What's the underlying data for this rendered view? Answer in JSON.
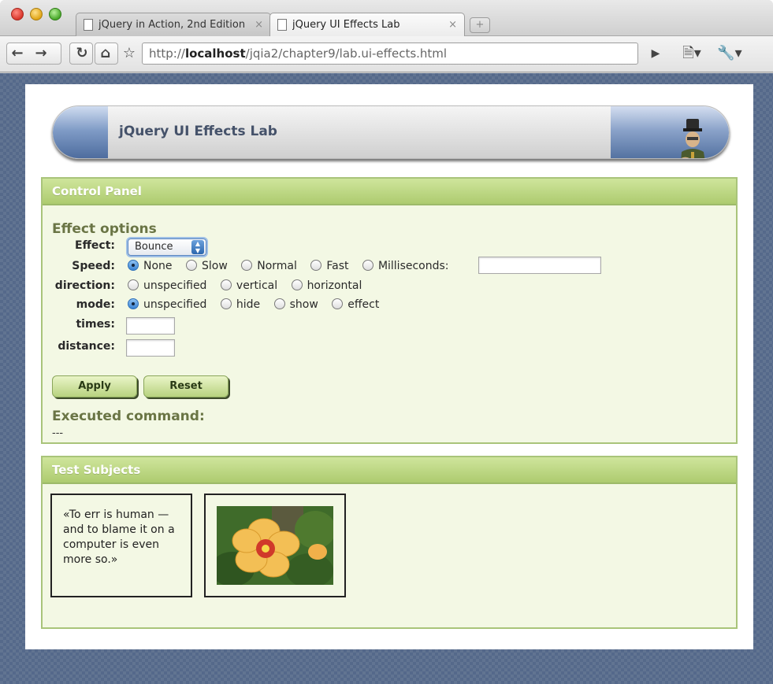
{
  "browser": {
    "tabs": [
      {
        "title": "jQuery in Action, 2nd Edition",
        "active": false
      },
      {
        "title": "jQuery UI Effects Lab",
        "active": true
      }
    ],
    "close_glyph": "×",
    "new_tab_glyph": "+",
    "url_prefix": "http://",
    "url_host": "localhost",
    "url_path": "/jqia2/chapter9/lab.ui-effects.html",
    "icons": [
      "back-arrow-icon",
      "forward-arrow-icon",
      "reload-icon",
      "home-icon",
      "bookmark-star-icon",
      "page-menu-icon",
      "wrench-icon"
    ]
  },
  "banner": {
    "title": "jQuery UI Effects Lab"
  },
  "control_panel": {
    "title": "Control Panel",
    "section_title": "Effect options",
    "effect": {
      "label": "Effect:",
      "selected": "Bounce"
    },
    "speed": {
      "label": "Speed:",
      "options": [
        "None",
        "Slow",
        "Normal",
        "Fast",
        "Milliseconds:"
      ],
      "selected": "None",
      "ms_value": ""
    },
    "direction": {
      "label": "direction:",
      "options": [
        "unspecified",
        "vertical",
        "horizontal"
      ],
      "selected": null
    },
    "mode": {
      "label": "mode:",
      "options": [
        "unspecified",
        "hide",
        "show",
        "effect"
      ],
      "selected": "unspecified"
    },
    "times": {
      "label": "times:",
      "value": ""
    },
    "distance": {
      "label": "distance:",
      "value": ""
    },
    "apply_label": "Apply",
    "reset_label": "Reset",
    "executed_title": "Executed command:",
    "executed_value": "---"
  },
  "test_subjects": {
    "title": "Test Subjects",
    "quote": "«To err is human — and to blame it on a computer is even more so.»",
    "image": "hibiscus-flower-image"
  },
  "colors": {
    "panel_header": "#b7d27f",
    "panel_body": "#f3f8e4",
    "panel_border": "#a9c47a",
    "page_background": "#55698a",
    "radio_selected": "#3a83d3"
  }
}
